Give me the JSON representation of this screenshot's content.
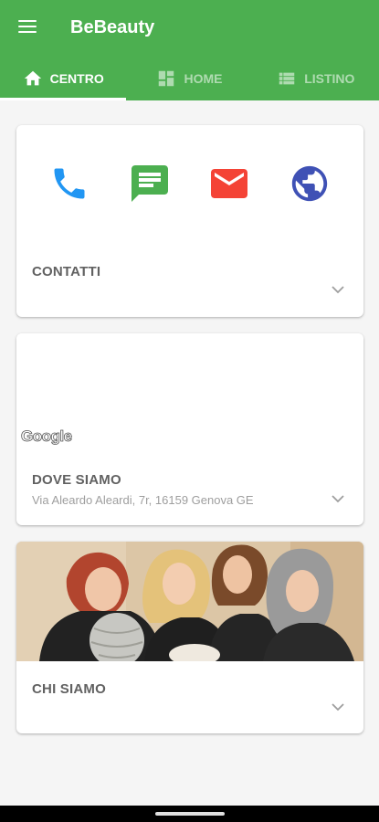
{
  "app": {
    "title": "BeBeauty"
  },
  "tabs": [
    {
      "label": "CENTRO",
      "icon": "home-icon",
      "active": true
    },
    {
      "label": "HOME",
      "icon": "dashboard-icon",
      "active": false
    },
    {
      "label": "LISTINO",
      "icon": "list-icon",
      "active": false
    }
  ],
  "contacts": {
    "label": "CONTATTI",
    "icons": [
      "phone-icon",
      "message-icon",
      "mail-icon",
      "globe-icon"
    ],
    "colors": {
      "phone": "#2196f3",
      "message": "#4caf50",
      "mail": "#f44336",
      "globe": "#3f51b5"
    }
  },
  "location": {
    "map_brand": "Google",
    "label": "DOVE SIAMO",
    "address": "Via Aleardo Aleardi, 7r, 16159 Genova GE"
  },
  "about": {
    "label": "CHI SIAMO"
  },
  "colors": {
    "primary": "#4caf50",
    "background": "#f5f5f5"
  }
}
